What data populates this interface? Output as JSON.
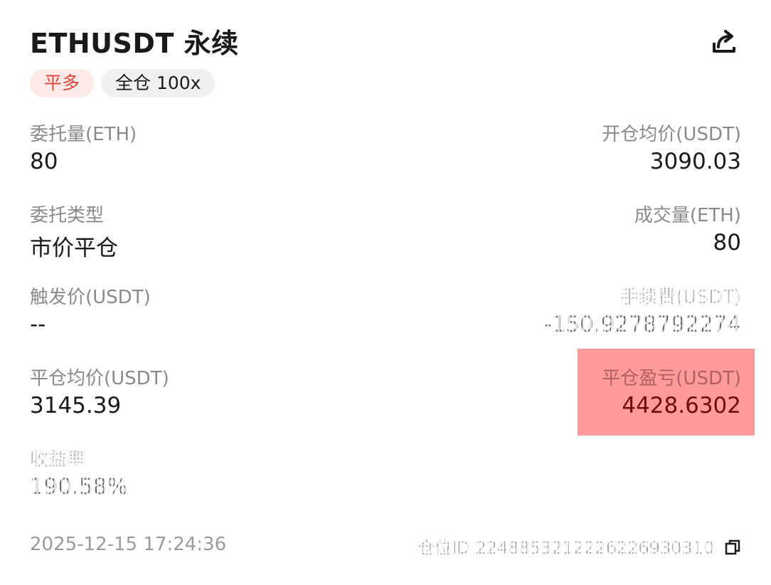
{
  "header": {
    "title": "ETHUSDT 永续",
    "share_icon": "share-icon"
  },
  "tags": {
    "side": "平多",
    "mode": "全仓 100x"
  },
  "fields": {
    "order_qty_label": "委托量(ETH)",
    "order_qty_value": "80",
    "open_avg_label": "开仓均价(USDT)",
    "open_avg_value": "3090.03",
    "order_type_label": "委托类型",
    "order_type_value": "市价平仓",
    "filled_qty_label": "成交量(ETH)",
    "filled_qty_value": "80",
    "trigger_label": "触发价(USDT)",
    "trigger_value": "--",
    "fee_label": "手续费(USDT)",
    "fee_value": "-150.9278792274",
    "close_avg_label": "平仓均价(USDT)",
    "close_avg_value": "3145.39",
    "close_pnl_label": "平仓盈亏(USDT)",
    "close_pnl_value": "4428.6302",
    "roi_label": "收益率",
    "roi_value": "190.58%"
  },
  "footer": {
    "time": "2025-12-15 17:24:36",
    "position_id": "仓位ID 2248853212226226930310",
    "copy_icon": "copy-icon"
  },
  "colors": {
    "accent_red": "#e0463a",
    "highlight": "#ff9a9a"
  }
}
